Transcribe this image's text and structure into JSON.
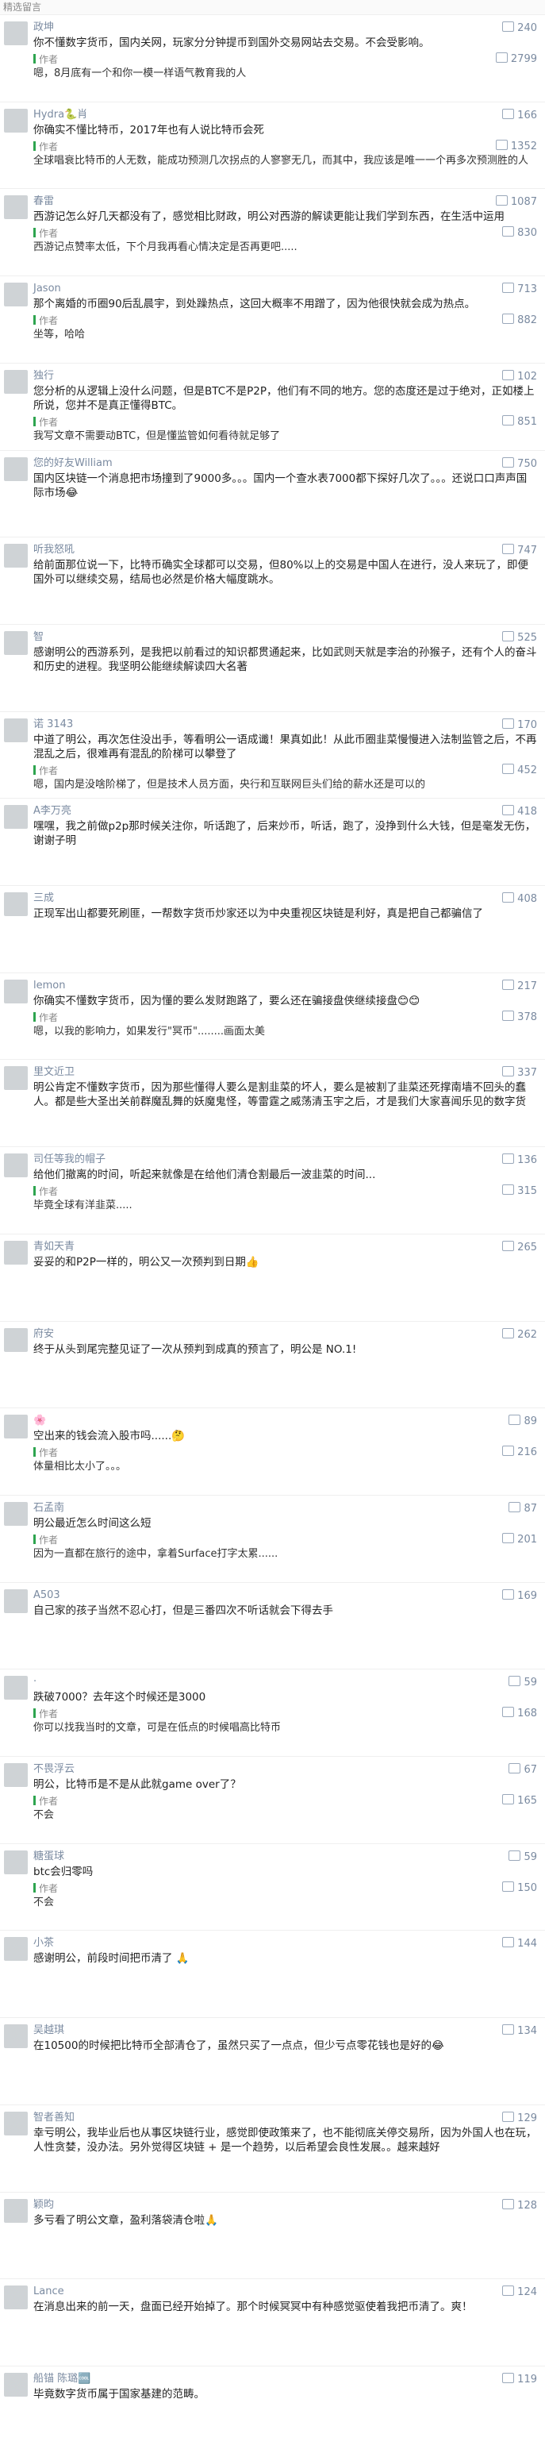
{
  "section_title": "精选留言",
  "author_label": "作者",
  "comments": [
    {
      "user": "政坤",
      "likes": "240",
      "text": "你不懂数字货币，国内关网，玩家分分钟提币到国外交易网站去交易。不会受影响。",
      "reply_likes": "2799",
      "reply": "嗯，8月底有一个和你一模一样语气教育我的人"
    },
    {
      "user": "Hydra🐍肖",
      "likes": "166",
      "text": "你确实不懂比特币，2017年也有人说比特币会死",
      "reply_likes": "1352",
      "reply": "全球唱衰比特币的人无数，能成功预测几次拐点的人寥寥无几，而其中，我应该是唯一一个再多次预测胜的人中，还会在低谷的时候预测涨回来的人。"
    },
    {
      "user": "春雷",
      "likes": "1087",
      "text": "西游记怎么好几天都没有了，感觉相比财政，明公对西游的解读更能让我们学到东西，在生活中运用",
      "reply_likes": "830",
      "reply": "西游记点赞率太低，下个月我再看心情决定是否再更吧....."
    },
    {
      "user": "Jason",
      "likes": "713",
      "text": "那个离婚的币圈90后乱晨宇，到处躁热点，这回大概率不用蹭了，因为他很快就会成为热点。",
      "reply_likes": "882",
      "reply": "坐等，哈哈"
    },
    {
      "user": "独行",
      "likes": "102",
      "text": "您分析的从逻辑上没什么问题，但是BTC不是P2P，他们有不同的地方。您的态度还是过于绝对，正如楼上所说，您并不是真正懂得BTC。",
      "reply_likes": "851",
      "reply": "我写文章不需要动BTC，但是懂监管如何看待就足够了"
    },
    {
      "user": "您的好友William",
      "likes": "750",
      "text": "国内区块链一个消息把市场撞到了9000多。。。国内一个查水表7000都下探好几次了。。。还说口口声声国际市场😂",
      "reply_likes": "",
      "reply": ""
    },
    {
      "user": "听我怒吼",
      "likes": "747",
      "text": "给前面那位说一下，比特币确实全球都可以交易，但80%以上的交易是中国人在进行，没人来玩了，即便国外可以继续交易，结局也必然是价格大幅度跳水。",
      "reply_likes": "",
      "reply": ""
    },
    {
      "user": "智",
      "likes": "525",
      "text": "感谢明公的西游系列，是我把以前看过的知识都贯通起来，比如武则天就是李治的孙猴子，还有个人的奋斗和历史的进程。我坚明公能继续解读四大名著",
      "reply_likes": "",
      "reply": ""
    },
    {
      "user": "诺 3143",
      "likes": "170",
      "text": "中道了明公，再次怎住没出手，等看明公一语成谶！果真如此！从此币圈韭菜慢慢进入法制监管之后，不再混乱之后，很难再有混乱的阶梯可以攀登了",
      "reply_likes": "452",
      "reply": "嗯，国内是没啥阶梯了，但是技术人员方面，央行和互联网巨头们给的薪水还是可以的"
    },
    {
      "user": "A李万亮",
      "likes": "418",
      "text": "嘿嘿，我之前做p2p那时候关注你，听话跑了，后来炒币，听话，跑了，没挣到什么大钱，但是毫发无伤，谢谢子明",
      "reply_likes": "",
      "reply": ""
    },
    {
      "user": "三成",
      "likes": "408",
      "text": "正现军出山都要死刷匪，一帮数字货币炒家还以为中央重视区块链是利好，真是把自己都骗信了",
      "reply_likes": "",
      "reply": ""
    },
    {
      "user": "lemon",
      "likes": "217",
      "text": "你确实不懂数字货币，因为懂的要么发财跑路了，要么还在骗接盘侠继续接盘😊😊",
      "reply_likes": "378",
      "reply": "嗯，以我的影响力，如果发行\"冥币\"........画面太美"
    },
    {
      "user": "里文近卫",
      "likes": "337",
      "text": "明公肯定不懂数字货币，因为那些懂得人要么是割韭菜的坏人，要么是被割了韭菜还死撑南墙不回头的蠢人。都是些大圣出关前群魔乱舞的妖魔鬼怪，等雷霆之威荡清玉宇之后，才是我们大家喜闻乐见的数字货币。",
      "reply_likes": "",
      "reply": ""
    },
    {
      "user": "司任等我的帽子",
      "likes": "136",
      "text": "给他们撤离的时间，听起来就像是在给他们清仓割最后一波韭菜的时间...",
      "reply_likes": "315",
      "reply": "毕竟全球有洋韭菜....."
    },
    {
      "user": "青如天青",
      "likes": "265",
      "text": "妥妥的和P2P一样的，明公又一次预判到日期👍",
      "reply_likes": "",
      "reply": ""
    },
    {
      "user": "府安",
      "likes": "262",
      "text": "终于从头到尾完整见证了一次从预判到成真的预言了，明公是 NO.1!",
      "reply_likes": "",
      "reply": ""
    },
    {
      "user": "🌸",
      "likes": "89",
      "text": "空出来的钱会流入股市吗......🤔",
      "reply_likes": "216",
      "reply": "体量相比太小了。。。"
    },
    {
      "user": "石孟南",
      "likes": "87",
      "text": "明公最近怎么时间这么短",
      "reply_likes": "201",
      "reply": "因为一直都在旅行的途中，拿着Surface打字太累......"
    },
    {
      "user": "A503",
      "likes": "169",
      "text": "自己家的孩子当然不忍心打，但是三番四次不听话就会下得去手",
      "reply_likes": "",
      "reply": ""
    },
    {
      "user": "·",
      "likes": "59",
      "text": "跌破7000？去年这个时候还是3000",
      "reply_likes": "168",
      "reply": "你可以找我当时的文章，可是在低点的时候唱高比特币"
    },
    {
      "user": "不畏浮云",
      "likes": "67",
      "text": "明公，比特币是不是从此就game over了？",
      "reply_likes": "165",
      "reply": "不会"
    },
    {
      "user": "糖蛋球",
      "likes": "59",
      "text": "btc会归零吗",
      "reply_likes": "150",
      "reply": "不会"
    },
    {
      "user": "小茶",
      "likes": "144",
      "text": "感谢明公，前段时间把币清了 🙏",
      "reply_likes": "",
      "reply": ""
    },
    {
      "user": "吴越琪",
      "likes": "134",
      "text": "在10500的时候把比特币全部清仓了，虽然只买了一点点，但少亏点零花钱也是好的😂",
      "reply_likes": "",
      "reply": ""
    },
    {
      "user": "智者善知",
      "likes": "129",
      "text": "幸亏明公，我毕业后也从事区块链行业，感觉即使政策来了，也不能彻底关停交易所，因为外国人也在玩，人性贪婪，没办法。另外觉得区块链 + 是一个趋势，以后希望会良性发展。。越来越好",
      "reply_likes": "",
      "reply": ""
    },
    {
      "user": "颖昀",
      "likes": "128",
      "text": "多亏看了明公文章，盈利落袋清仓啦🙏",
      "reply_likes": "",
      "reply": ""
    },
    {
      "user": "Lance",
      "likes": "124",
      "text": "在消息出来的前一天，盘面已经开始掉了。那个时候冥冥中有种感觉驱使着我把币清了。爽！",
      "reply_likes": "",
      "reply": ""
    },
    {
      "user": "船锚 陈璐🆒",
      "likes": "119",
      "text": "毕竟数字货币属于国家基建的范畴。",
      "reply_likes": "",
      "reply": ""
    }
  ]
}
